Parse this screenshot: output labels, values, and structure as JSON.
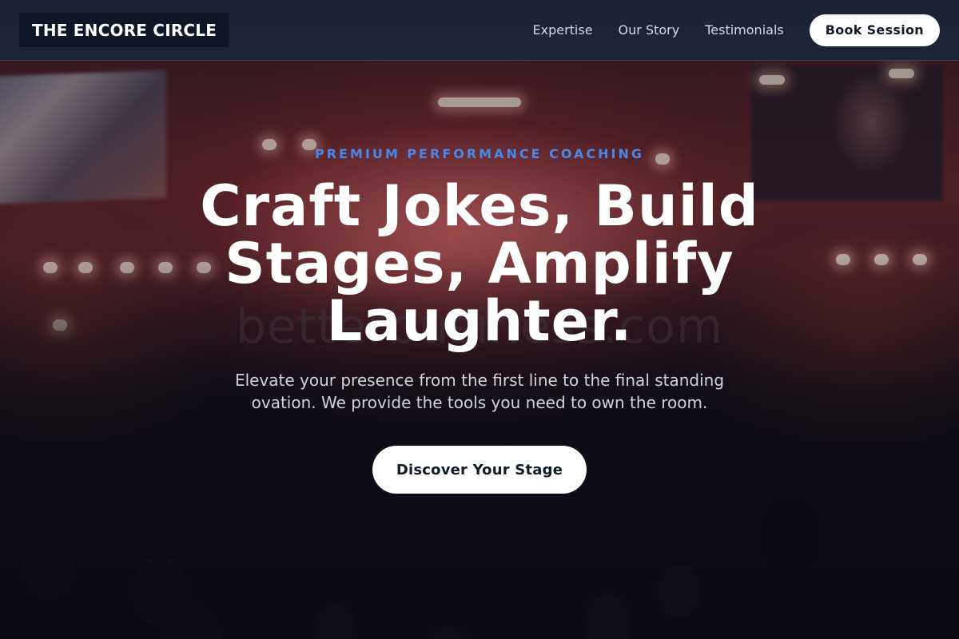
{
  "brand": {
    "name": "THE ENCORE CIRCLE"
  },
  "nav": {
    "links": [
      "Expertise",
      "Our Story",
      "Testimonials"
    ],
    "cta_label": "Book Session"
  },
  "hero": {
    "eyebrow": "PREMIUM PERFORMANCE COACHING",
    "headline": "Craft Jokes, Build Stages, Amplify Laughter.",
    "subtext": "Elevate your presence from the first line to the final standing ovation. We provide the tools you need to own the room.",
    "cta_label": "Discover Your Stage",
    "watermark": "betterbusiness.com"
  },
  "colors": {
    "accent": "#4a87e8",
    "navbar": "#1c2438",
    "button_bg": "#ffffff",
    "button_text": "#131a28"
  }
}
